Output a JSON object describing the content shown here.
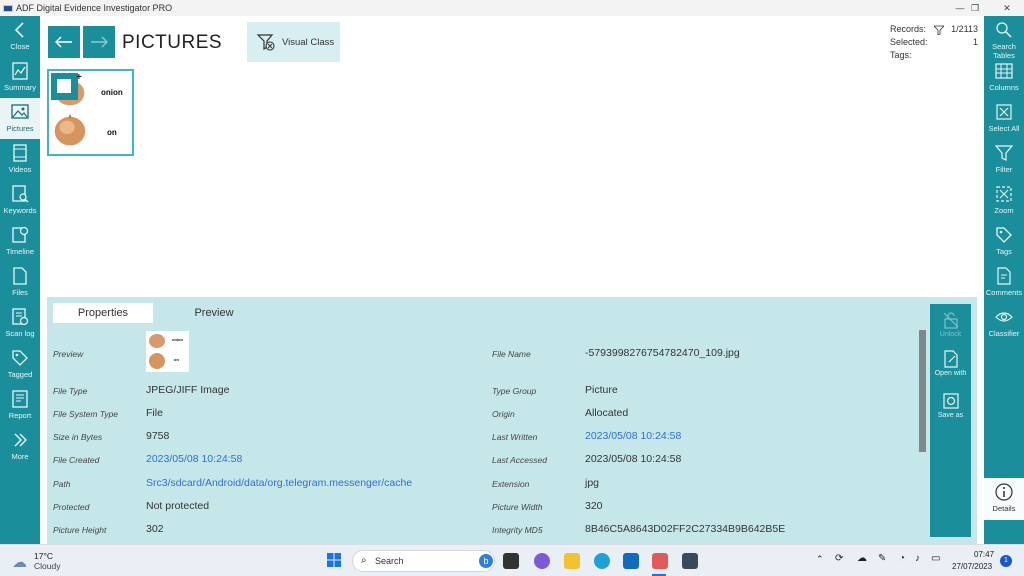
{
  "window": {
    "title": "ADF Digital Evidence Investigator PRO"
  },
  "left_nav": {
    "items": [
      {
        "label": "Close",
        "icon": "close-arrow-icon"
      },
      {
        "label": "Summary",
        "icon": "summary-icon"
      },
      {
        "label": "Pictures",
        "icon": "pictures-icon",
        "active": true
      },
      {
        "label": "Videos",
        "icon": "videos-icon"
      },
      {
        "label": "Keywords",
        "icon": "keywords-icon"
      },
      {
        "label": "Timeline",
        "icon": "timeline-icon"
      },
      {
        "label": "Files",
        "icon": "files-icon"
      },
      {
        "label": "Scan log",
        "icon": "scan-log-icon"
      },
      {
        "label": "Tagged",
        "icon": "tagged-icon"
      },
      {
        "label": "Report",
        "icon": "report-icon"
      },
      {
        "label": "More",
        "icon": "more-icon"
      }
    ]
  },
  "right_nav": {
    "items": [
      {
        "label": "Search Tables",
        "icon": "search-icon"
      },
      {
        "label": "Columns",
        "icon": "columns-icon"
      },
      {
        "label": "Select All",
        "icon": "select-all-icon"
      },
      {
        "label": "Filter",
        "icon": "filter-icon"
      },
      {
        "label": "Zoom",
        "icon": "zoom-icon"
      },
      {
        "label": "Tags",
        "icon": "tag-icon"
      },
      {
        "label": "Comments",
        "icon": "comment-icon"
      },
      {
        "label": "Classifier",
        "icon": "eye-icon"
      }
    ],
    "details_label": "Details"
  },
  "header": {
    "title": "PICTURES",
    "visual_class_label": "Visual Class"
  },
  "stats": {
    "records_label": "Records:",
    "records_value": "1/2113",
    "selected_label": "Selected:",
    "selected_value": "1",
    "tags_label": "Tags:",
    "tags_value": ""
  },
  "thumbnail": {
    "line1": "onion",
    "line2": "on"
  },
  "properties": {
    "tabs": [
      "Properties",
      "Preview"
    ],
    "preview_label": "Preview",
    "preview_text": {
      "line1": "onion",
      "line2": "on"
    },
    "left": [
      {
        "label": "File Type",
        "value": "JPEG/JIFF Image"
      },
      {
        "label": "File System Type",
        "value": "File"
      },
      {
        "label": "Size in Bytes",
        "value": "9758"
      },
      {
        "label": "File Created",
        "value": "2023/05/08 10:24:58",
        "link": true
      },
      {
        "label": "Path",
        "value": "Src3/sdcard/Android/data/org.telegram.messenger/cache",
        "link": true
      },
      {
        "label": "Protected",
        "value": "Not protected"
      },
      {
        "label": "Picture Height",
        "value": "302"
      }
    ],
    "file_name_label": "File Name",
    "file_name": "-5793998276754782470_109.jpg",
    "right": [
      {
        "label": "Type Group",
        "value": "Picture"
      },
      {
        "label": "Origin",
        "value": "Allocated"
      },
      {
        "label": "Last Written",
        "value": "2023/05/08 10:24:58",
        "link": true
      },
      {
        "label": "Last Accessed",
        "value": "2023/05/08 10:24:58"
      },
      {
        "label": "Extension",
        "value": "jpg"
      },
      {
        "label": "Picture Width",
        "value": "320"
      },
      {
        "label": "Integrity MD5",
        "value": "8B46C5A8643D02FF2C27334B9B642B5E"
      }
    ],
    "actions": [
      {
        "label": "Unlock",
        "disabled": true
      },
      {
        "label": "Open with"
      },
      {
        "label": "Save as"
      }
    ]
  },
  "taskbar": {
    "weather_temp": "17°C",
    "weather_desc": "Cloudy",
    "search_placeholder": "Search",
    "time": "07:47",
    "date": "27/07/2023",
    "notification_count": "1"
  }
}
